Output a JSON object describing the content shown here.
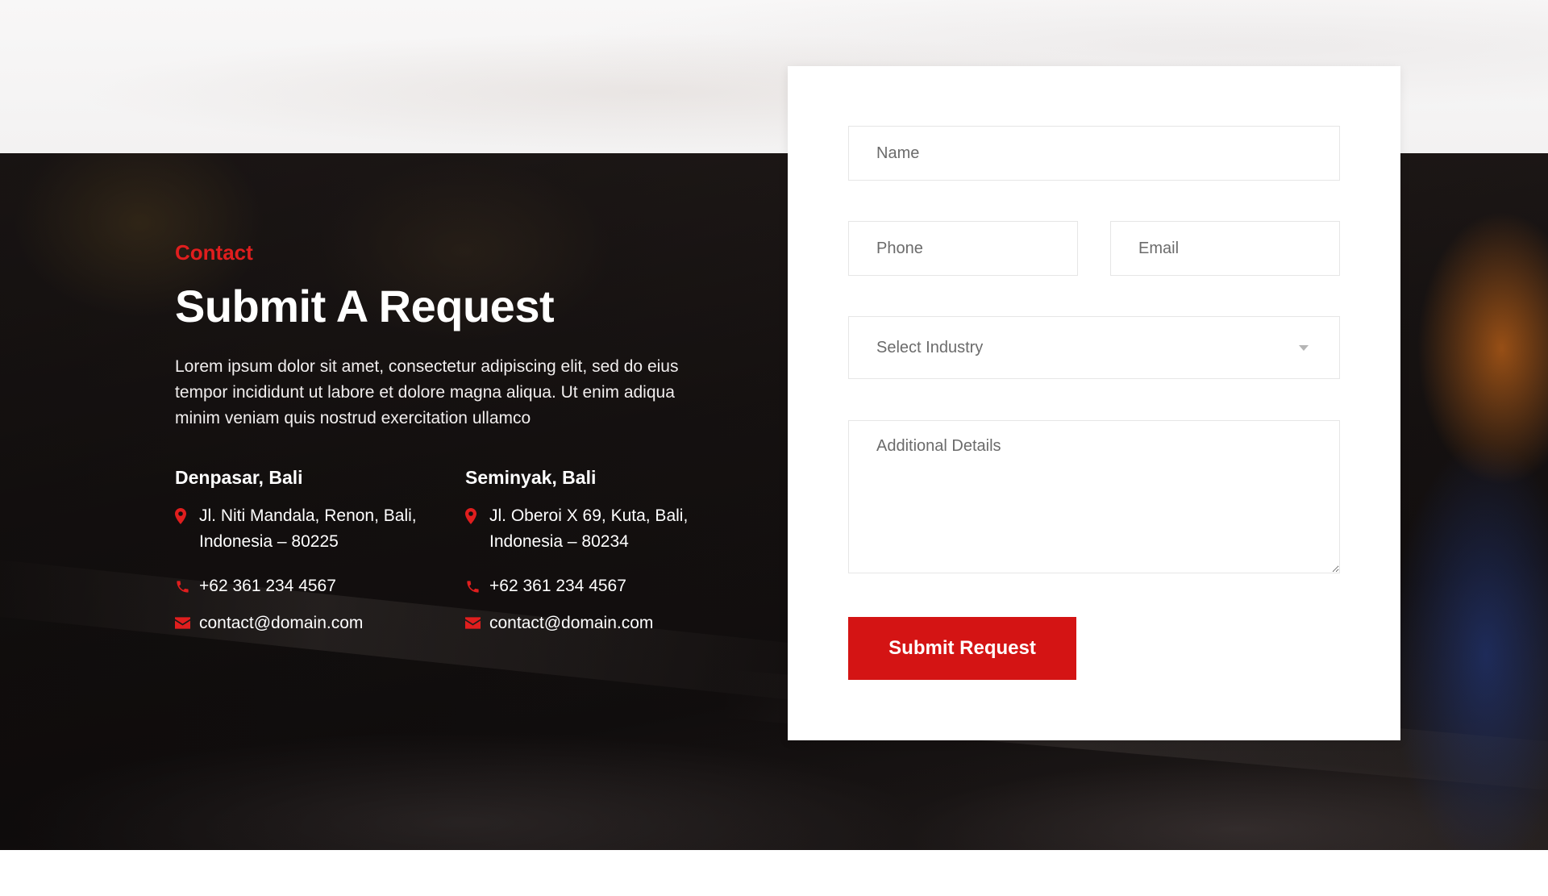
{
  "section": {
    "eyebrow": "Contact",
    "title": "Submit A Request",
    "description": "Lorem ipsum dolor sit amet, consectetur adipiscing elit, sed do eius tempor incididunt ut labore et dolore magna aliqua. Ut enim adiqua minim veniam quis nostrud exercitation ullamco"
  },
  "offices": [
    {
      "name": "Denpasar, Bali",
      "address_line1": "Jl. Niti Mandala, Renon, Bali,",
      "address_line2": "Indonesia – 80225",
      "phone": "+62 361 234 4567",
      "email": "contact@domain.com",
      "icons": {
        "address": "map-pin-icon",
        "phone": "phone-icon",
        "email": "envelope-icon"
      }
    },
    {
      "name": "Seminyak, Bali",
      "address_line1": "Jl. Oberoi X 69, Kuta, Bali,",
      "address_line2": "Indonesia – 80234",
      "phone": "+62 361 234 4567",
      "email": "contact@domain.com",
      "icons": {
        "address": "map-pin-icon",
        "phone": "phone-icon",
        "email": "envelope-icon"
      }
    }
  ],
  "form": {
    "name_placeholder": "Name",
    "phone_placeholder": "Phone",
    "email_placeholder": "Email",
    "industry_placeholder": "Select Industry",
    "details_placeholder": "Additional Details",
    "submit_label": "Submit Request"
  },
  "colors": {
    "accent": "#d41414",
    "eyebrow": "#e01e1e",
    "card_background": "#ffffff",
    "field_border": "#e6e6e6",
    "hero_background": "#171211"
  }
}
